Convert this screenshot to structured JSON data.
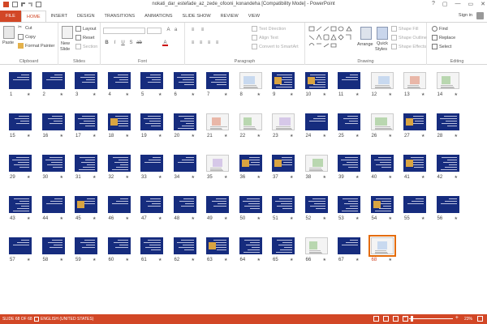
{
  "window": {
    "title": "nokati_dar_estefade_az_zede_ofooni_konandeha [Compatibility Mode] - PowerPoint",
    "controls": [
      "?",
      "▢",
      "—",
      "▭",
      "✕"
    ]
  },
  "tabs": [
    {
      "label": "FILE",
      "kind": "file"
    },
    {
      "label": "HOME",
      "kind": "active"
    },
    {
      "label": "INSERT"
    },
    {
      "label": "DESIGN"
    },
    {
      "label": "TRANSITIONS"
    },
    {
      "label": "ANIMATIONS"
    },
    {
      "label": "SLIDE SHOW"
    },
    {
      "label": "REVIEW"
    },
    {
      "label": "VIEW"
    }
  ],
  "signin": "Sign in",
  "ribbon": {
    "clipboard": {
      "label": "Clipboard",
      "paste": "Paste",
      "cut": "Cut",
      "copy": "Copy",
      "format_painter": "Format Painter"
    },
    "slides": {
      "label": "Slides",
      "new_slide": "New",
      "new_slide2": "Slide",
      "layout": "Layout",
      "reset": "Reset",
      "section": "Section"
    },
    "font": {
      "label": "Font"
    },
    "paragraph": {
      "label": "Paragraph",
      "text_direction": "Text Direction",
      "align_text": "Align Text",
      "convert_smartart": "Convert to SmartArt"
    },
    "drawing": {
      "label": "Drawing",
      "arrange": "Arrange",
      "quick_styles": "Quick",
      "quick_styles2": "Styles",
      "shape_fill": "Shape Fill",
      "shape_outline": "Shape Outline",
      "shape_effects": "Shape Effects"
    },
    "editing": {
      "label": "Editing",
      "find": "Find",
      "replace": "Replace",
      "select": "Select"
    }
  },
  "slides": {
    "total": 68,
    "selected": 68,
    "white_slides": [
      8,
      12,
      13,
      14,
      21,
      22,
      23,
      26,
      35,
      38,
      66,
      68
    ],
    "star": "★"
  },
  "status": {
    "slide_indicator": "SLIDE 68 OF 68",
    "language": "ENGLISH (UNITED STATES)",
    "zoom": "23%",
    "zoom_level": 0.23
  },
  "colors": {
    "accent": "#d24726",
    "slide_blue": "#162c7e",
    "selection": "#e46c0a"
  }
}
